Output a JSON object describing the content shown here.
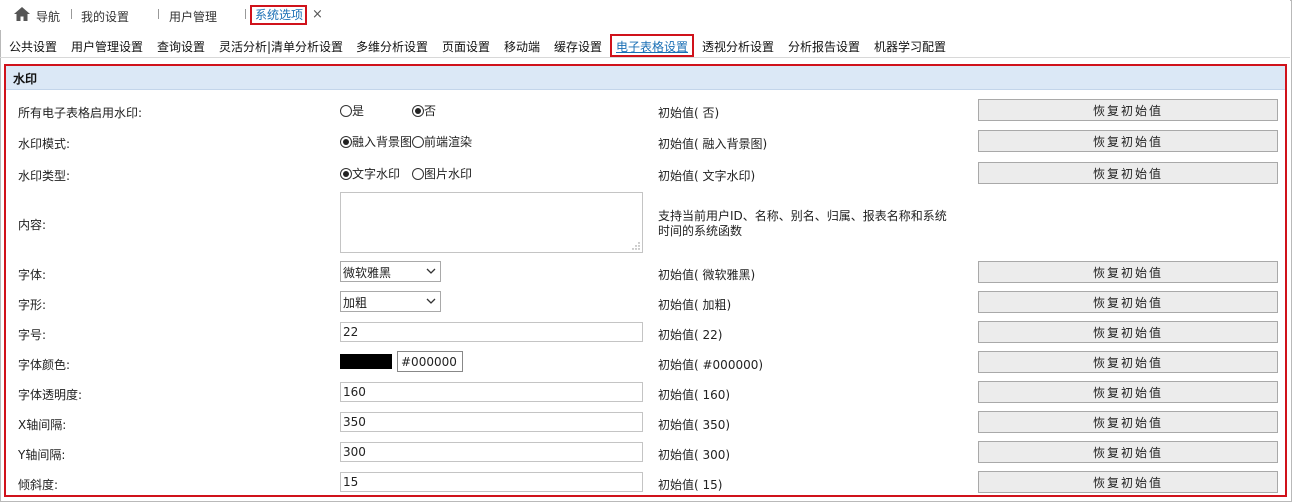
{
  "topbar": {
    "home_label": "导航",
    "my_settings": "我的设置",
    "user_mgmt": "用户管理",
    "active_tab": "系统选项",
    "close": "×"
  },
  "categories": [
    "公共设置",
    "用户管理设置",
    "查询设置",
    "灵活分析|清单分析设置",
    "多维分析设置",
    "页面设置",
    "移动端",
    "缓存设置",
    "电子表格设置",
    "透视分析设置",
    "分析报告设置",
    "机器学习配置"
  ],
  "active_category": "电子表格设置",
  "panel": {
    "title": "水印",
    "reset_label": "恢复初始值",
    "rows": {
      "enable": {
        "label": "所有电子表格启用水印:",
        "opt_yes": "是",
        "opt_no": "否",
        "selected": "否",
        "init": "初始值( 否)"
      },
      "mode": {
        "label": "水印模式:",
        "opt_a": "融入背景图",
        "opt_b": "前端渲染",
        "selected": "融入背景图",
        "init": "初始值( 融入背景图)"
      },
      "type": {
        "label": "水印类型:",
        "opt_a": "文字水印",
        "opt_b": "图片水印",
        "selected": "文字水印",
        "init": "初始值( 文字水印)"
      },
      "content": {
        "label": "内容:",
        "value": "",
        "hint": "支持当前用户ID、名称、别名、归属、报表名称和系统时间的系统函数"
      },
      "font": {
        "label": "字体:",
        "value": "微软雅黑",
        "init": "初始值( 微软雅黑)"
      },
      "style": {
        "label": "字形:",
        "value": "加粗",
        "init": "初始值( 加粗)"
      },
      "size": {
        "label": "字号:",
        "value": "22",
        "init": "初始值( 22)"
      },
      "color": {
        "label": "字体颜色:",
        "value": "#000000",
        "swatch": "#000000",
        "init": "初始值( #000000)"
      },
      "opacity": {
        "label": "字体透明度:",
        "value": "160",
        "init": "初始值( 160)"
      },
      "x_gap": {
        "label": "X轴间隔:",
        "value": "350",
        "init": "初始值( 350)"
      },
      "y_gap": {
        "label": "Y轴间隔:",
        "value": "300",
        "init": "初始值( 300)"
      },
      "tilt": {
        "label": "倾斜度:",
        "value": "15",
        "init": "初始值( 15)"
      }
    }
  },
  "colors": {
    "accent": "#1a6fb5",
    "highlight": "#d0121b",
    "panel_header": "#dbe8f6"
  }
}
